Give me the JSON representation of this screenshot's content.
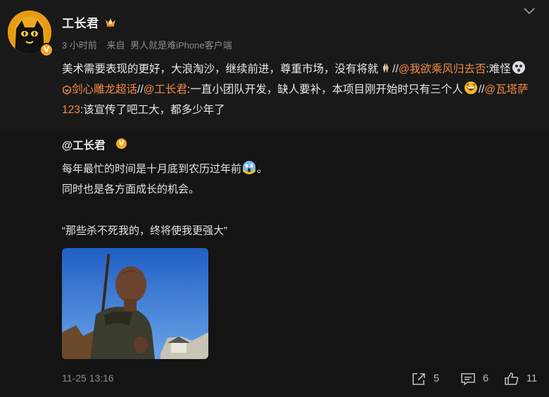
{
  "post": {
    "author": "工长君",
    "time": "3 小时前",
    "source_prefix": "来自",
    "source": "男人就是难iPhone客户端",
    "repost_text": {
      "t1": "美术需要表现的更好，大浪淘沙，继续前进，尊重市场，没有将就",
      "sep1": "//",
      "m1": "@我欲乘风归去否",
      "t2": ":难怪",
      "topic": "剑心雕龙超话",
      "sep2": "//",
      "m2": "@工长君",
      "t3": ":一直小团队开发，缺人要补，本项目刚开始时只有三个人",
      "sep3": "//",
      "m3": "@瓦塔萨123",
      "t4": ":该宣传了吧工大，都多少年了"
    },
    "icons": {
      "verified_badge": "V",
      "crown": "crown-icon",
      "more": "chevron-down-icon"
    }
  },
  "original": {
    "author": "@工长君",
    "badge": "V",
    "line1": "每年最忙的时间是十月底到农历过年前",
    "line2": "同时也是各方面成长的机会。",
    "quote": "“那些杀不死我的，终将使我更强大”",
    "date": "11-25 13:16",
    "actions": {
      "repost": "5",
      "comment": "6",
      "like": "11"
    }
  },
  "colors": {
    "mention": "#f28a45",
    "background": "#141414",
    "top_background": "#191919",
    "badge": "#f5a623"
  }
}
